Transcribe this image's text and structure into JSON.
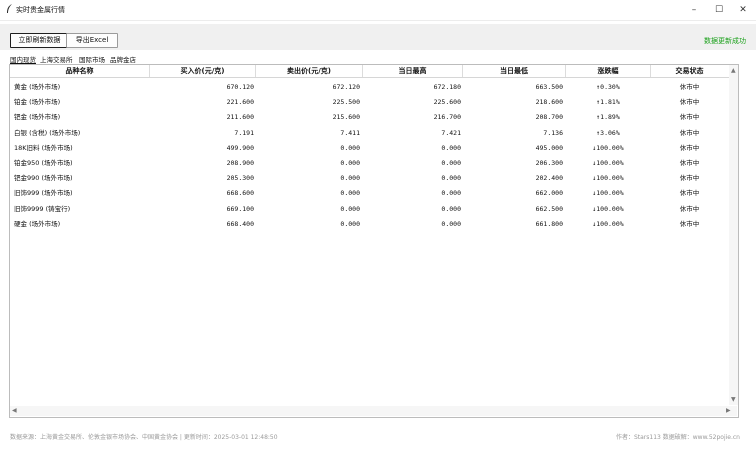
{
  "window": {
    "title": "实时贵金属行情",
    "minimize_icon": "minimize-icon",
    "maximize_icon": "maximize-icon",
    "close_icon": "close-icon"
  },
  "toolbar": {
    "refresh_label": "立即刷新数据",
    "export_label": "导出Excel",
    "status_text": "数据更新成功",
    "status_color": "#1aa01a"
  },
  "tabs": [
    "国内现货",
    "上海交易所",
    "国际市场",
    "品牌金店"
  ],
  "table": {
    "columns": [
      "品种名称",
      "买入价(元/克)",
      "卖出价(元/克)",
      "当日最高",
      "当日最低",
      "涨跌幅",
      "交易状态"
    ],
    "rows": [
      {
        "name": "黄金 (场外市场)",
        "buy": "670.120",
        "sell": "672.120",
        "high": "672.180",
        "low": "663.500",
        "change": "↑0.30%",
        "status": "休市中"
      },
      {
        "name": "铂金 (场外市场)",
        "buy": "221.600",
        "sell": "225.500",
        "high": "225.600",
        "low": "218.600",
        "change": "↑1.81%",
        "status": "休市中"
      },
      {
        "name": "钯金 (场外市场)",
        "buy": "211.600",
        "sell": "215.600",
        "high": "216.700",
        "low": "208.700",
        "change": "↑1.89%",
        "status": "休市中"
      },
      {
        "name": "白银 (含税) (场外市场)",
        "buy": "7.191",
        "sell": "7.411",
        "high": "7.421",
        "low": "7.136",
        "change": "↑3.06%",
        "status": "休市中"
      },
      {
        "name": "18K旧料 (场外市场)",
        "buy": "499.900",
        "sell": "0.000",
        "high": "0.000",
        "low": "495.000",
        "change": "↓100.00%",
        "status": "休市中"
      },
      {
        "name": "铂金950 (场外市场)",
        "buy": "208.900",
        "sell": "0.000",
        "high": "0.000",
        "low": "206.300",
        "change": "↓100.00%",
        "status": "休市中"
      },
      {
        "name": "钯金990 (场外市场)",
        "buy": "205.300",
        "sell": "0.000",
        "high": "0.000",
        "low": "202.400",
        "change": "↓100.00%",
        "status": "休市中"
      },
      {
        "name": "旧饰999 (场外市场)",
        "buy": "668.600",
        "sell": "0.000",
        "high": "0.000",
        "low": "662.000",
        "change": "↓100.00%",
        "status": "休市中"
      },
      {
        "name": "旧饰9999 (铸宝行)",
        "buy": "669.100",
        "sell": "0.000",
        "high": "0.000",
        "low": "662.500",
        "change": "↓100.00%",
        "status": "休市中"
      },
      {
        "name": "硬金 (场外市场)",
        "buy": "668.400",
        "sell": "0.000",
        "high": "0.000",
        "low": "661.800",
        "change": "↓100.00%",
        "status": "休市中"
      }
    ]
  },
  "footer": {
    "left": "数据来源：上海黄金交易所、伦敦金银市场协会、中国黄金协会 | 更新时间：2025-03-01 12:48:50",
    "right": "作者：Stars113  数据破解：www.52pojie.cn"
  }
}
